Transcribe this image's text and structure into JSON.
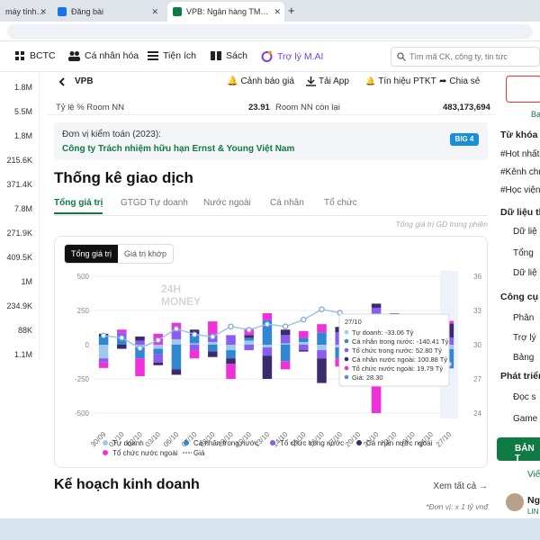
{
  "browser": {
    "tabs": [
      {
        "label": "máy tính, ..."
      },
      {
        "label": "Đăng bài"
      },
      {
        "label": "VPB: Ngân hàng TMCP Việt Nam..."
      }
    ],
    "new_tab": "+"
  },
  "sitenav": {
    "items": [
      "BCTC",
      "Cá nhân hóa",
      "Tiện ích",
      "Sách",
      "Trợ lý M.AI"
    ],
    "search_placeholder": "Tìm mã CK, công ty, tin tức"
  },
  "leftcol": [
    "1.8M",
    "5.5M",
    "1.8M",
    "215.6K",
    "371.4K",
    "7.8M",
    "271.9K",
    "409.5K",
    "1M",
    "234.9K",
    "88K",
    "1.1M"
  ],
  "header": {
    "ticker": "VPB",
    "alert": "Cảnh báo giá",
    "download": "Tải App",
    "signal": "Tín hiệu PTKT",
    "share": "Chia sẻ"
  },
  "room": {
    "label1": "Tỷ lệ % Room NN",
    "value1": "23.91",
    "label2": "Room NN còn lại",
    "value2": "483,173,694"
  },
  "audit": {
    "label": "Đơn vị kiểm toán (2023):",
    "company": "Công ty Trách nhiệm hữu hạn Ernst & Young Việt Nam",
    "logo": "BIG 4"
  },
  "section_title": "Thống kê giao dịch",
  "subtabs": [
    "Tổng giá trị",
    "GTGD Tự doanh",
    "Nước ngoài",
    "Cá nhân",
    "Tổ chức"
  ],
  "note": "Tổng giá trị GD trong phiên",
  "toggle": {
    "on": "Tổng giá trị",
    "off": "Giá trị khớp"
  },
  "watermark": {
    "top": "24H",
    "bottom": "MONEY"
  },
  "tooltip": {
    "date": "27/10",
    "lines": [
      {
        "label": "Tự doanh: -33.06 Tỷ",
        "color": "#9ec9ea"
      },
      {
        "label": "Cá nhân trong nước: -140.41 Tỷ",
        "color": "#2f86d1"
      },
      {
        "label": "Tổ chức trong nước: 52.80 Tỷ",
        "color": "#8a5cf0"
      },
      {
        "label": "Cá nhân nước ngoài: 100.88 Tỷ",
        "color": "#3b2a6e"
      },
      {
        "label": "Tổ chức nước ngoài: 19.79 Tỷ",
        "color": "#f030d8"
      },
      {
        "label": "Giá: 28.30",
        "color": "#5a8fd6"
      }
    ]
  },
  "chart_data": {
    "type": "bar",
    "stacked": true,
    "categories": [
      "30/09",
      "01/10",
      "02/10",
      "03/10",
      "06/10",
      "07/10",
      "08/10",
      "09/10",
      "10/10",
      "13/10",
      "14/10",
      "15/10",
      "16/10",
      "17/10",
      "20/10",
      "21/10",
      "22/10",
      "23/10",
      "24/10",
      "27/10"
    ],
    "ylim_left": [
      -500,
      500
    ],
    "yticks_left": [
      -500,
      -250,
      0,
      250,
      500
    ],
    "ylim_right": [
      24,
      36
    ],
    "yticks_right": [
      24,
      27,
      30,
      33,
      36
    ],
    "series": [
      {
        "name": "Tự doanh",
        "color": "#9ec9ea",
        "values": [
          -100,
          0,
          -20,
          -30,
          40,
          10,
          20,
          -40,
          30,
          -20,
          10,
          20,
          -40,
          -20,
          30,
          40,
          -50,
          20,
          10,
          -33
        ]
      },
      {
        "name": "Cá nhân trong nước",
        "color": "#2f86d1",
        "values": [
          60,
          50,
          -80,
          -40,
          -180,
          60,
          -50,
          -60,
          20,
          180,
          -120,
          30,
          90,
          -80,
          -150,
          -280,
          200,
          -70,
          -40,
          -140
        ]
      },
      {
        "name": "Tổ chức trong nước",
        "color": "#8a5cf0",
        "values": [
          -30,
          40,
          30,
          -60,
          60,
          -40,
          60,
          70,
          -40,
          -60,
          60,
          -40,
          -60,
          90,
          20,
          230,
          -100,
          40,
          60,
          53
        ]
      },
      {
        "name": "Cá nhân nước ngoài",
        "color": "#3b2a6e",
        "values": [
          20,
          -30,
          30,
          -20,
          -40,
          40,
          -40,
          -40,
          20,
          -170,
          40,
          -10,
          -180,
          40,
          10,
          30,
          30,
          -160,
          -90,
          101
        ]
      },
      {
        "name": "Tổ chức nước ngoài",
        "color": "#f030d8",
        "values": [
          -40,
          20,
          -130,
          80,
          60,
          -60,
          90,
          -110,
          50,
          50,
          -60,
          50,
          60,
          -60,
          140,
          -220,
          -60,
          60,
          -120,
          20
        ]
      }
    ],
    "price": {
      "name": "Giá",
      "color": "#5a8fd6",
      "values": [
        30.8,
        30.6,
        29.7,
        30.4,
        31.4,
        30.9,
        30.7,
        31.6,
        31.3,
        31.8,
        31.6,
        32.2,
        33.1,
        32.8,
        31.9,
        31.1,
        30.5,
        30.0,
        29.0,
        28.3
      ]
    },
    "legend": [
      "Tự doanh",
      "Cá nhân trong nước",
      "Tổ chức trong nước",
      "Cá nhân nước ngoài",
      "Tổ chức nước ngoài",
      "Giá"
    ],
    "legend_placement": "bottom",
    "grid": true
  },
  "kehoach": {
    "title": "Kế hoạch kinh doanh",
    "more": "Xem tất cả",
    "unit": "*Đơn vị: x 1 tỷ vnđ"
  },
  "rightcol": [
    "Từ khóa",
    "#Hot nhất",
    "#Kênh chu",
    "#Học viện",
    "Dữ liệu thị",
    "Dữ liệ",
    "Tổng",
    "Dữ liệ",
    "Công cụ đ",
    "Phân",
    "Trợ lý",
    "Bảng",
    "Phát triển",
    "Đọc s",
    "Game",
    "BẢN T",
    "Viết",
    "Ng",
    "LIN"
  ],
  "colors": {
    "brand": "#0f7a43",
    "ai": "#7a3cf0",
    "active_tab": "#0f7a43"
  }
}
